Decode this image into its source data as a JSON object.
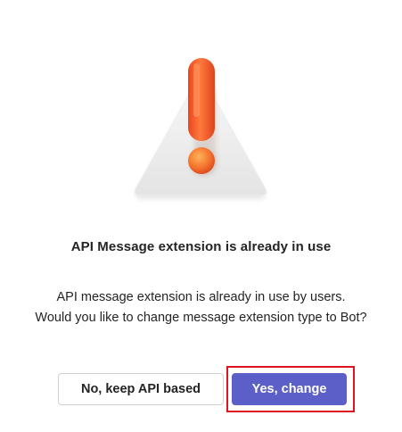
{
  "dialog": {
    "title": "API Message extension is already in use",
    "message_line1": "API message extension is already in use by users.",
    "message_line2": "Would you like to change message extension type to Bot?",
    "illustration_icon": "warning-exclamation-icon",
    "secondary_button_label": "No, keep API based",
    "primary_button_label": "Yes, change",
    "colors": {
      "primary": "#5b5fc7",
      "text": "#242424",
      "highlight": "#e0141e",
      "exclamation": "#f0582a"
    }
  }
}
